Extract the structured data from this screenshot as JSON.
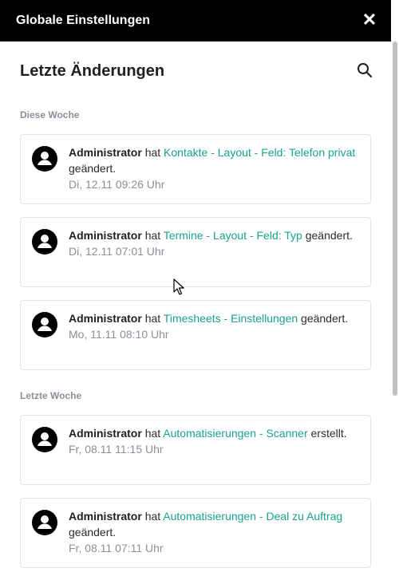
{
  "header": {
    "title": "Globale Einstellungen",
    "close_icon": "close-icon"
  },
  "panel": {
    "heading": "Letzte Änderungen",
    "search_icon": "search-icon"
  },
  "sections": [
    {
      "label": "Diese Woche",
      "items": [
        {
          "user": "Administrator",
          "verb": "hat",
          "link": "Kontakte - Layout - Feld: Telefon privat",
          "action": "geändert.",
          "date": "Di, 12.11 09:26 Uhr"
        },
        {
          "user": "Administrator",
          "verb": "hat",
          "link": "Termine - Layout - Feld: Typ",
          "action": "geändert.",
          "date": "Di, 12.11 07:01 Uhr"
        },
        {
          "user": "Administrator",
          "verb": "hat",
          "link": "Timesheets - Einstellungen",
          "action": "geändert.",
          "date": "Mo, 11.11 08:10 Uhr"
        }
      ]
    },
    {
      "label": "Letzte Woche",
      "items": [
        {
          "user": "Administrator",
          "verb": "hat",
          "link": "Automatisierungen - Scanner",
          "action": "erstellt.",
          "date": "Fr, 08.11 11:15 Uhr"
        },
        {
          "user": "Administrator",
          "verb": "hat",
          "link": "Automatisierungen - Deal zu Auftrag",
          "action": "geändert.",
          "date": "Fr, 08.11 07:11 Uhr"
        }
      ]
    }
  ],
  "colors": {
    "header_bg": "#000000",
    "link": "#1aa28a",
    "muted": "#8a8f98",
    "border": "#e3e5e8"
  }
}
